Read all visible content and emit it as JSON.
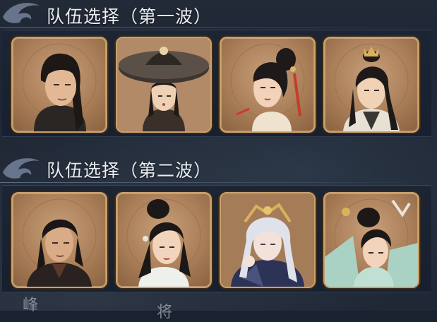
{
  "waves": [
    {
      "title": "队伍选择（第一波）",
      "members": [
        {
          "icon": "male-swordsman-portrait-icon"
        },
        {
          "icon": "hat-woman-portrait-icon"
        },
        {
          "icon": "red-tassel-woman-portrait-icon"
        },
        {
          "icon": "crowned-scholar-portrait-icon"
        }
      ]
    },
    {
      "title": "队伍选择（第二波）",
      "members": [
        {
          "icon": "dark-robe-man-portrait-icon"
        },
        {
          "icon": "white-robe-woman-portrait-icon"
        },
        {
          "icon": "silver-hair-portrait-icon"
        },
        {
          "icon": "green-robe-woman-portrait-icon"
        }
      ]
    }
  ],
  "footer": {
    "left_glyph": "峰",
    "right_glyph": "将"
  },
  "colors": {
    "card_border": "#c9a26c",
    "card_bg": "#a97e58",
    "panel_bg": "#1c2534",
    "title": "#e9ecf0"
  }
}
